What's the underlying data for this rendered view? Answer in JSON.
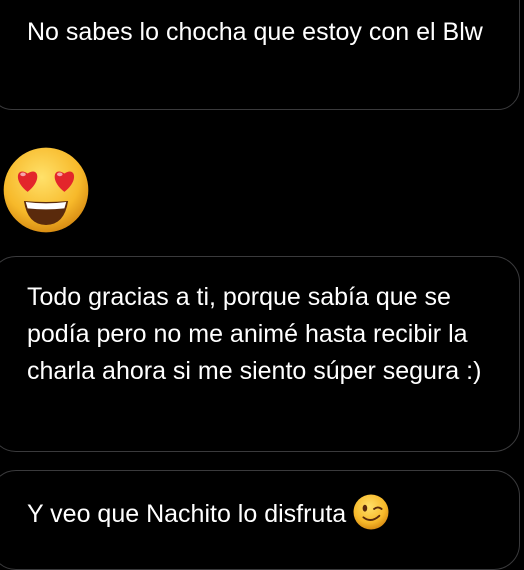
{
  "messages": [
    {
      "text": "No sabes lo chocha que estoy con el Blw"
    },
    {
      "emoji": "heart-eyes-emoji"
    },
    {
      "text": "Todo gracias a ti, porque sabía que se podía pero no me animé hasta recibir la charla ahora si me siento súper segura :)"
    },
    {
      "text": "Y veo que Nachito lo disfruta",
      "emoji": "winking-face-emoji"
    }
  ],
  "colors": {
    "background": "#000000",
    "bubble_border": "#3a3a3c",
    "text": "#ffffff",
    "emoji_face": "#f7b92a",
    "heart": "#e3252b"
  }
}
